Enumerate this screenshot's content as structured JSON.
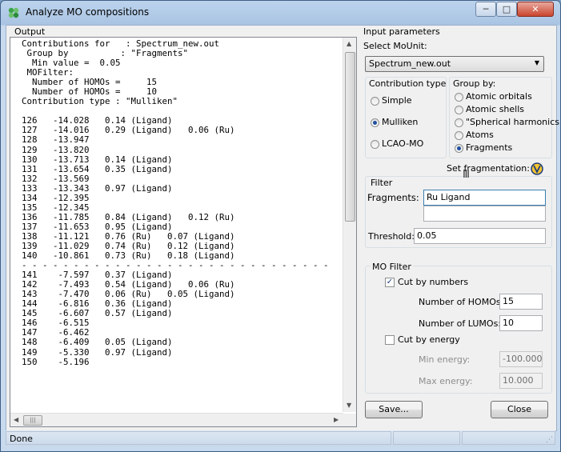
{
  "window": {
    "title": "Analyze MO compositions"
  },
  "output": {
    "title": "Output",
    "text": "Contributions for   : Spectrum_new.out\n Group by          : \"Fragments\"\n  Min value =  0.05\n MOFilter:\n  Number of HOMOs =     15\n  Number of HOMOs =     10\nContribution type : \"Mulliken\"\n\n126   -14.028   0.14 (Ligand)\n127   -14.016   0.29 (Ligand)   0.06 (Ru)\n128   -13.947\n129   -13.820\n130   -13.713   0.14 (Ligand)\n131   -13.654   0.35 (Ligand)\n132   -13.569\n133   -13.343   0.97 (Ligand)\n134   -12.395\n135   -12.345\n136   -11.785   0.84 (Ligand)   0.12 (Ru)\n137   -11.653   0.95 (Ligand)\n138   -11.121   0.76 (Ru)   0.07 (Ligand)\n139   -11.029   0.74 (Ru)   0.12 (Ligand)\n140   -10.861   0.73 (Ru)   0.18 (Ligand)\n- - - - - - - - - - - - - - - - - - - - - - - - - - - - - -\n141    -7.597   0.37 (Ligand)\n142    -7.493   0.54 (Ligand)   0.06 (Ru)\n143    -7.470   0.06 (Ru)   0.05 (Ligand)\n144    -6.816   0.36 (Ligand)\n145    -6.607   0.57 (Ligand)\n146    -6.515\n147    -6.462\n148    -6.409   0.05 (Ligand)\n149    -5.330   0.97 (Ligand)\n150    -5.196"
  },
  "input": {
    "title": "Input parameters",
    "select_label": "Select MoUnit:",
    "mounit": "Spectrum_new.out",
    "contribution": {
      "title": "Contribution type",
      "options": [
        "Simple",
        "Mulliken",
        "LCAO-MO"
      ],
      "selected": "Mulliken"
    },
    "groupby": {
      "title": "Group by:",
      "options": [
        "Atomic orbitals",
        "Atomic shells",
        "\"Spherical harmonics\"",
        "Atoms",
        "Fragments"
      ],
      "selected": "Fragments"
    },
    "set_fragmentation_label": "Set fragmentation:",
    "filter": {
      "title": "Filter",
      "fragments_label": "Fragments:",
      "fragments_value": "Ru Ligand",
      "threshold_label": "Threshold:",
      "threshold_value": "0.05"
    },
    "mofilter": {
      "title": "MO Filter",
      "cut_by_numbers_label": "Cut by numbers",
      "cut_by_numbers_checked": true,
      "homos_label": "Number of HOMOs:",
      "homos_value": "15",
      "lumos_label": "Number of LUMOs:",
      "lumos_value": "10",
      "cut_by_energy_label": "Cut by energy",
      "cut_by_energy_checked": false,
      "min_energy_label": "Min energy:",
      "min_energy_value": "-100.000",
      "max_energy_label": "Max energy:",
      "max_energy_value": "10.000"
    },
    "save_label": "Save...",
    "close_label": "Close"
  },
  "status": {
    "text": "Done"
  }
}
